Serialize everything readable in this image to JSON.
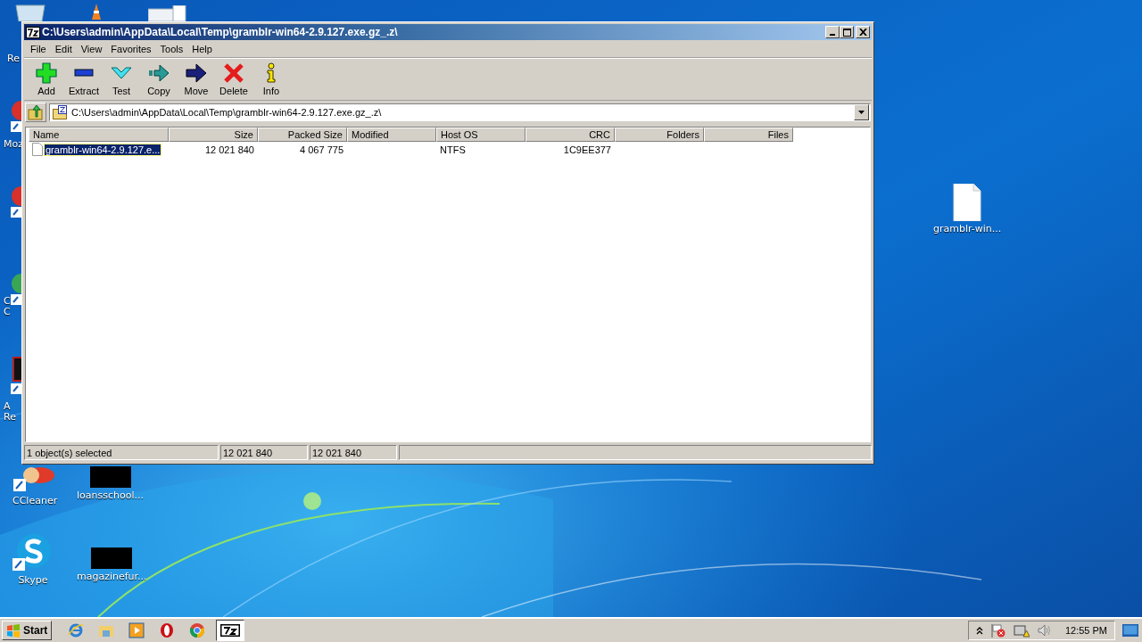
{
  "desktop_icons": [
    {
      "kind": "recycle-bin",
      "lines": [
        "Re"
      ]
    },
    {
      "kind": "cone"
    },
    {
      "kind": "document"
    },
    {
      "kind": "browser-red",
      "lines": [
        "Moz"
      ]
    },
    {
      "kind": "app-red"
    },
    {
      "kind": "app-green",
      "lines": [
        "C",
        "C"
      ]
    },
    {
      "kind": "app-dark",
      "lines": [
        "A",
        "Re"
      ]
    },
    {
      "kind": "ccleaner",
      "lines": [
        "CCleaner"
      ]
    },
    {
      "kind": "black",
      "lines": [
        "loansschool..."
      ]
    },
    {
      "kind": "skype",
      "lines": [
        "Skype"
      ]
    },
    {
      "kind": "black",
      "lines": [
        "magazinefur..."
      ]
    },
    {
      "kind": "file",
      "lines": [
        "gramblr-win..."
      ]
    }
  ],
  "window": {
    "title": "C:\\Users\\admin\\AppData\\Local\\Temp\\gramblr-win64-2.9.127.exe.gz_.z\\"
  },
  "menu": [
    "File",
    "Edit",
    "View",
    "Favorites",
    "Tools",
    "Help"
  ],
  "toolbar": [
    {
      "kind": "add",
      "label": "Add"
    },
    {
      "kind": "extract",
      "label": "Extract"
    },
    {
      "kind": "test",
      "label": "Test"
    },
    {
      "kind": "copy",
      "label": "Copy"
    },
    {
      "kind": "move",
      "label": "Move"
    },
    {
      "kind": "delete",
      "label": "Delete"
    },
    {
      "kind": "info",
      "label": "Info"
    }
  ],
  "address": {
    "value": "C:\\Users\\admin\\AppData\\Local\\Temp\\gramblr-win64-2.9.127.exe.gz_.z\\"
  },
  "table": {
    "columns": [
      "Name",
      "Size",
      "Packed Size",
      "Modified",
      "Host OS",
      "CRC",
      "Folders",
      "Files"
    ],
    "rows": [
      {
        "selected": true,
        "name": "gramblr-win64-2.9.127.e...",
        "size": "12 021 840",
        "packed_size": "4 067 775",
        "host_os": "NTFS",
        "crc": "1C9EE377"
      }
    ]
  },
  "status_bar": [
    "1 object(s) selected",
    "12 021 840",
    "12 021 840"
  ],
  "taskbar": {
    "start": "Start",
    "apps": [
      {
        "kind": "ie",
        "selected": false
      },
      {
        "kind": "explorer",
        "selected": false
      },
      {
        "kind": "media",
        "selected": false
      },
      {
        "kind": "opera",
        "selected": false
      },
      {
        "kind": "chrome",
        "selected": false
      },
      {
        "kind": "sevenzip",
        "selected": true
      }
    ],
    "time": "12:55 PM"
  }
}
